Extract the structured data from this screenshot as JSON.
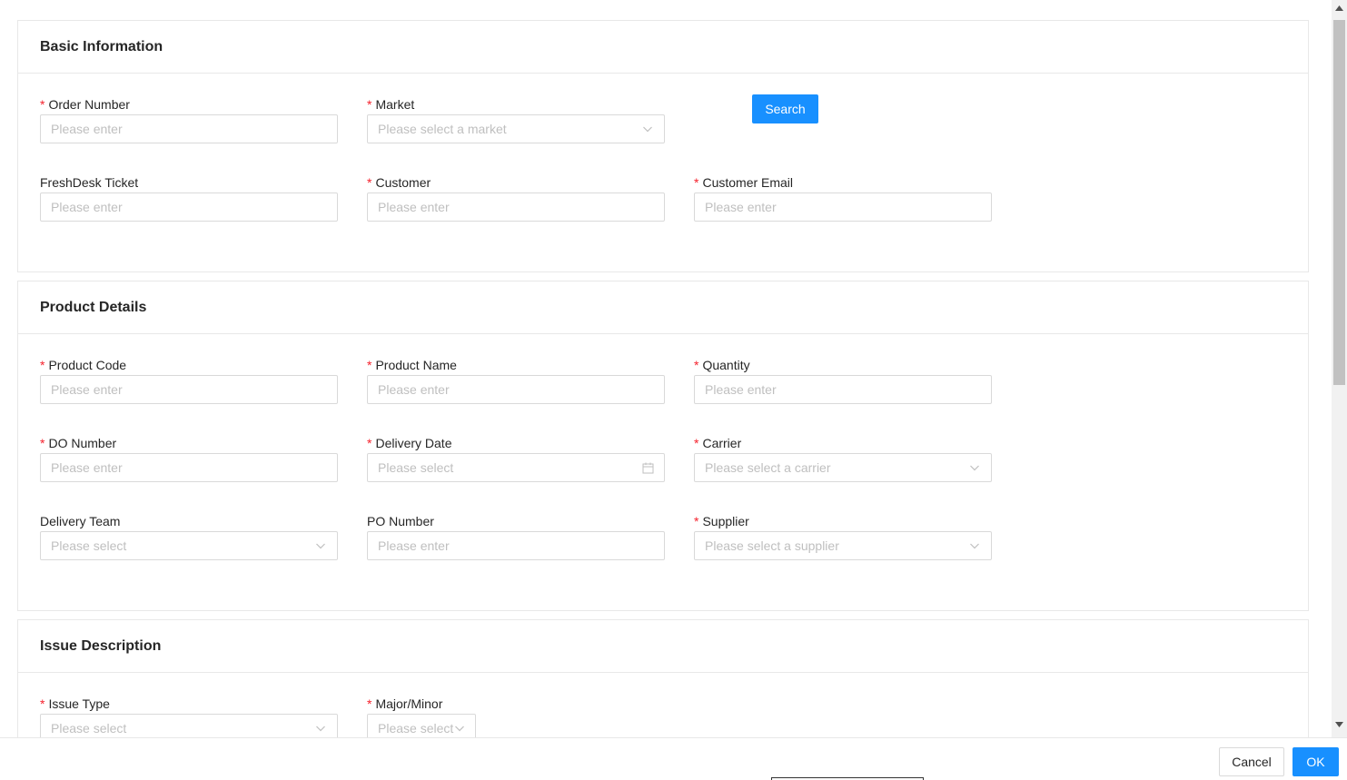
{
  "basic_info": {
    "title": "Basic Information",
    "order_number": {
      "label": "Order Number",
      "placeholder": "Please enter"
    },
    "market": {
      "label": "Market",
      "placeholder": "Please select a market"
    },
    "search_label": "Search",
    "freshdesk_ticket": {
      "label": "FreshDesk Ticket",
      "placeholder": "Please enter"
    },
    "customer": {
      "label": "Customer",
      "placeholder": "Please enter"
    },
    "customer_email": {
      "label": "Customer Email",
      "placeholder": "Please enter"
    }
  },
  "product_details": {
    "title": "Product Details",
    "product_code": {
      "label": "Product Code",
      "placeholder": "Please enter"
    },
    "product_name": {
      "label": "Product Name",
      "placeholder": "Please enter"
    },
    "quantity": {
      "label": "Quantity",
      "placeholder": "Please enter"
    },
    "do_number": {
      "label": "DO Number",
      "placeholder": "Please enter"
    },
    "delivery_date": {
      "label": "Delivery Date",
      "placeholder": "Please select"
    },
    "carrier": {
      "label": "Carrier",
      "placeholder": "Please select a carrier"
    },
    "delivery_team": {
      "label": "Delivery Team",
      "placeholder": "Please select"
    },
    "po_number": {
      "label": "PO Number",
      "placeholder": "Please enter"
    },
    "supplier": {
      "label": "Supplier",
      "placeholder": "Please select a supplier"
    }
  },
  "issue_description": {
    "title": "Issue Description",
    "issue_type": {
      "label": "Issue Type",
      "placeholder": "Please select"
    },
    "major_minor": {
      "label": "Major/Minor",
      "placeholder": "Please select"
    }
  },
  "footer": {
    "cancel_label": "Cancel",
    "ok_label": "OK"
  },
  "required_mark": "*",
  "colors": {
    "primary": "#1890ff",
    "required": "#f5222d",
    "border": "#d9d9d9",
    "placeholder": "#bfbfbf"
  },
  "icons": [
    "chevron-down-icon",
    "calendar-icon",
    "scroll-up-icon",
    "scroll-down-icon"
  ]
}
